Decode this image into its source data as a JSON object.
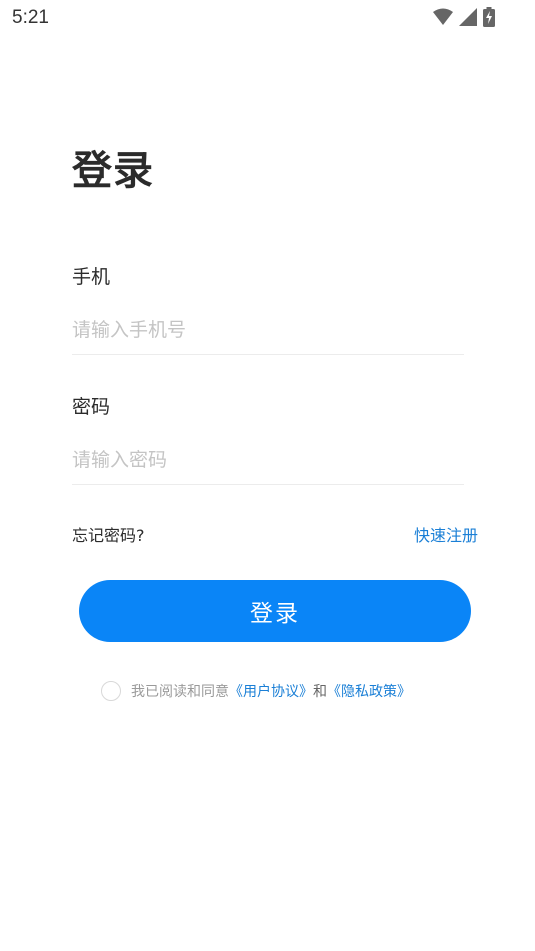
{
  "status_bar": {
    "time": "5:21",
    "icons": [
      "wifi-icon",
      "signal-icon",
      "battery-charging-icon"
    ]
  },
  "page": {
    "title": "登录"
  },
  "form": {
    "phone": {
      "label": "手机",
      "placeholder": "请输入手机号",
      "value": ""
    },
    "password": {
      "label": "密码",
      "placeholder": "请输入密码",
      "value": ""
    }
  },
  "links": {
    "forgot_password": "忘记密码?",
    "quick_register": "快速注册"
  },
  "login_button": {
    "label": "登录"
  },
  "agreement": {
    "checked": false,
    "prefix_text": "我已阅读和同意",
    "user_agreement": "《用户协议》",
    "conjunction": "和",
    "privacy_policy": "《隐私政策》"
  },
  "colors": {
    "accent": "#0a85f7",
    "link": "#1a7fd6",
    "text_primary": "#2b2b2b",
    "placeholder": "#c4c4c4",
    "divider": "#ececec"
  }
}
